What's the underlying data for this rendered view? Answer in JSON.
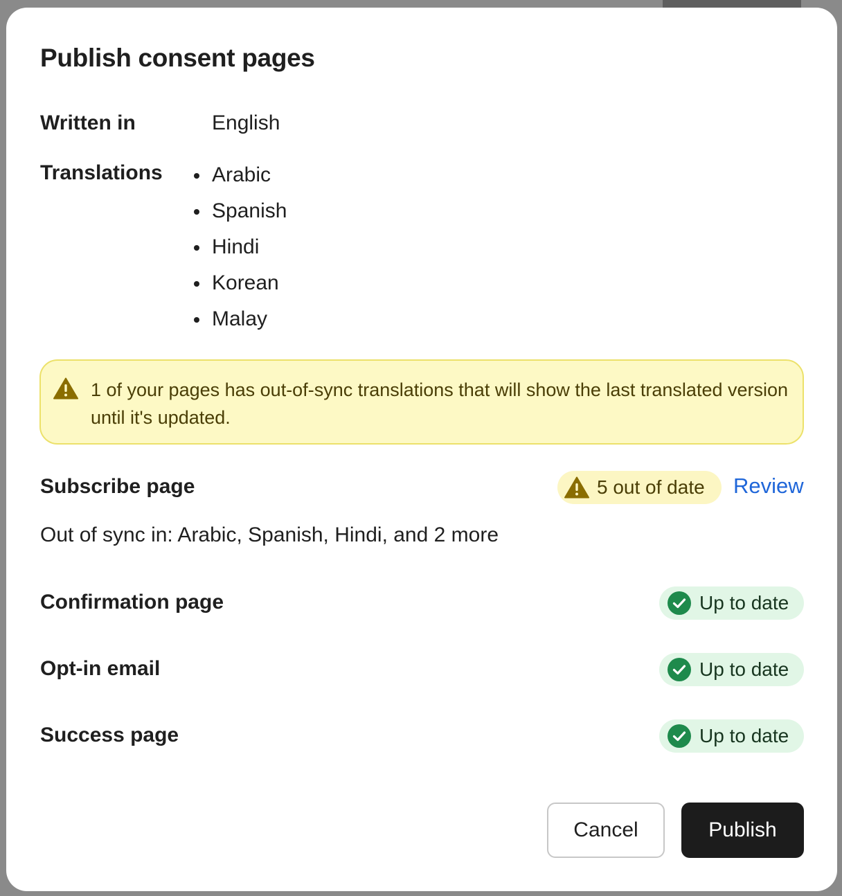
{
  "dialog": {
    "title": "Publish consent pages",
    "written_in_label": "Written in",
    "written_in_value": "English",
    "translations_label": "Translations",
    "translations": [
      "Arabic",
      "Spanish",
      "Hindi",
      "Korean",
      "Malay"
    ],
    "alert_text": "1 of your pages has out-of-sync translations that will show the last translated version until it's updated.",
    "pages": [
      {
        "name": "Subscribe page",
        "status": "5 out of date",
        "status_type": "warning",
        "action": "Review",
        "detail": "Out of sync in: Arabic, Spanish, Hindi, and 2 more"
      },
      {
        "name": "Confirmation page",
        "status": "Up to date",
        "status_type": "ok"
      },
      {
        "name": "Opt-in email",
        "status": "Up to date",
        "status_type": "ok"
      },
      {
        "name": "Success page",
        "status": "Up to date",
        "status_type": "ok"
      }
    ],
    "cancel_label": "Cancel",
    "publish_label": "Publish"
  },
  "colors": {
    "warning_icon": "#8a6d00",
    "success_icon": "#1e8a4c",
    "link": "#1f66d9",
    "primary_button": "#1c1c1c"
  },
  "icons": {
    "alert": "warning-triangle-icon",
    "ok": "check-circle-icon"
  }
}
